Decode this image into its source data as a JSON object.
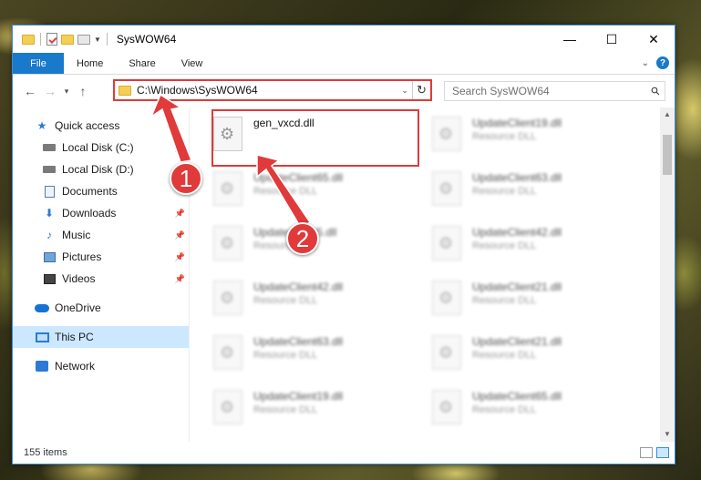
{
  "window": {
    "title": "SysWOW64",
    "controls": {
      "minimize": "—",
      "maximize": "☐",
      "close": "✕"
    }
  },
  "ribbon": {
    "tabs": [
      "File",
      "Home",
      "Share",
      "View"
    ],
    "help": "?"
  },
  "address": {
    "path": "C:\\Windows\\SysWOW64",
    "search_placeholder": "Search SysWOW64"
  },
  "sidebar": {
    "quick_access": "Quick access",
    "items": [
      {
        "label": "Local Disk (C:)",
        "pinned": true
      },
      {
        "label": "Local Disk (D:)",
        "pinned": false
      },
      {
        "label": "Documents",
        "pinned": false
      },
      {
        "label": "Downloads",
        "pinned": true
      },
      {
        "label": "Music",
        "pinned": true
      },
      {
        "label": "Pictures",
        "pinned": true
      },
      {
        "label": "Videos",
        "pinned": true
      }
    ],
    "onedrive": "OneDrive",
    "this_pc": "This PC",
    "network": "Network"
  },
  "files": [
    {
      "name": "gen_vxcd.dll",
      "type": ""
    },
    {
      "name": "UpdateClient19.dll",
      "type": "Resource DLL"
    },
    {
      "name": "UpdateClient65.dll",
      "type": "Resource DLL"
    },
    {
      "name": "UpdateClient63.dll",
      "type": "Resource DLL"
    },
    {
      "name": "UpdateClient5.dll",
      "type": "Resource DLL"
    },
    {
      "name": "UpdateClient42.dll",
      "type": "Resource DLL"
    },
    {
      "name": "UpdateClient42.dll",
      "type": "Resource DLL"
    },
    {
      "name": "UpdateClient21.dll",
      "type": "Resource DLL"
    },
    {
      "name": "UpdateClient63.dll",
      "type": "Resource DLL"
    },
    {
      "name": "UpdateClient21.dll",
      "type": "Resource DLL"
    },
    {
      "name": "UpdateClient19.dll",
      "type": "Resource DLL"
    },
    {
      "name": "UpdateClient65.dll",
      "type": "Resource DLL"
    }
  ],
  "status": {
    "item_count": "155 items"
  },
  "annotations": {
    "badge1": "1",
    "badge2": "2",
    "color": "#e03a3a"
  }
}
